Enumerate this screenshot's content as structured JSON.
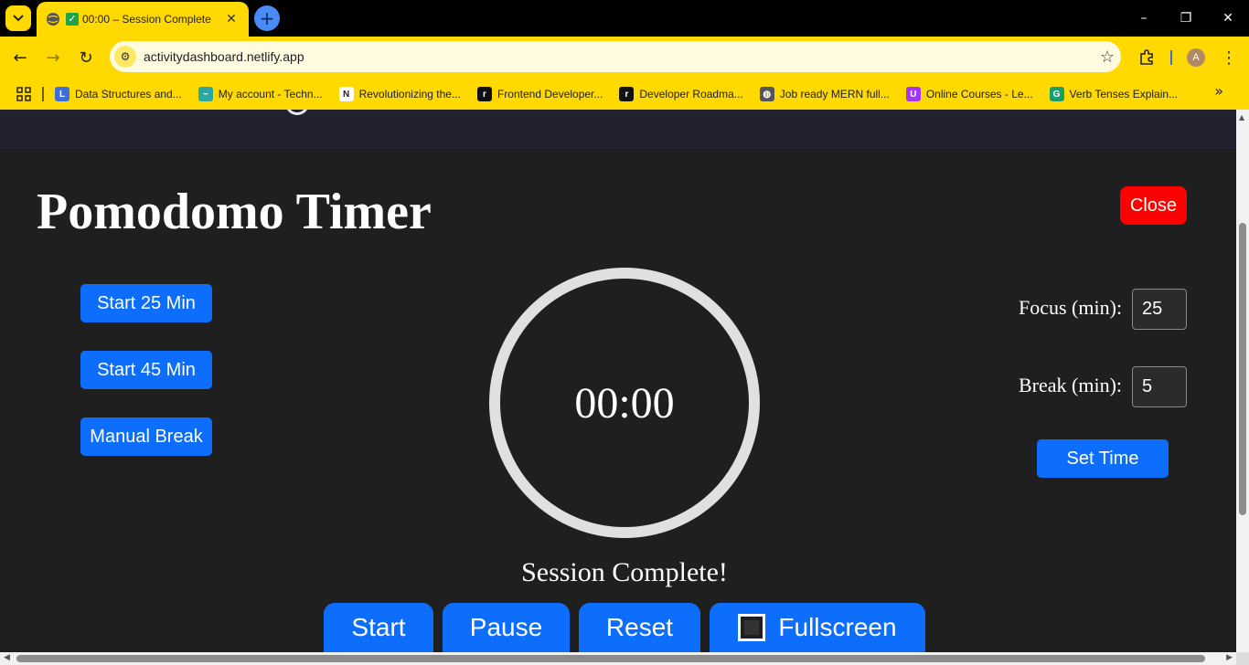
{
  "browser": {
    "tab": {
      "title": "00:00 – Session Complete"
    },
    "address": {
      "url": "activitydashboard.netlify.app"
    },
    "avatar_letter": "A",
    "bookmarks": [
      {
        "label": "Data Structures and...",
        "color": "#3b6fe0",
        "glyph": "L"
      },
      {
        "label": "My account - Techn...",
        "color": "#2aa7a0",
        "glyph": "~"
      },
      {
        "label": "Revolutionizing the...",
        "color": "#ffffff",
        "glyph": "N"
      },
      {
        "label": "Frontend Developer...",
        "color": "#111111",
        "glyph": "r"
      },
      {
        "label": "Developer Roadma...",
        "color": "#111111",
        "glyph": "r"
      },
      {
        "label": "Job ready MERN full...",
        "color": "#555555",
        "glyph": "◍"
      },
      {
        "label": "Online Courses - Le...",
        "color": "#a435f0",
        "glyph": "U"
      },
      {
        "label": "Verb Tenses Explain...",
        "color": "#1a9e6a",
        "glyph": "G"
      }
    ]
  },
  "page": {
    "title": "Pomodomo Timer",
    "close_label": "Close",
    "presets": [
      "Start 25 Min",
      "Start 45 Min",
      "Manual Break"
    ],
    "timer": {
      "display": "00:00",
      "status": "Session Complete!"
    },
    "settings": {
      "focus_label": "Focus (min):",
      "focus_value": "25",
      "break_label": "Break (min):",
      "break_value": "5",
      "set_time_label": "Set Time"
    },
    "controls": {
      "start": "Start",
      "pause": "Pause",
      "reset": "Reset",
      "fullscreen": "Fullscreen"
    }
  },
  "colors": {
    "chrome_yellow": "#ffd900",
    "page_bg": "#1f1f1f",
    "button_blue": "#0d6efd",
    "close_red": "#ff0000",
    "dial_ring": "#e0e0e0"
  }
}
